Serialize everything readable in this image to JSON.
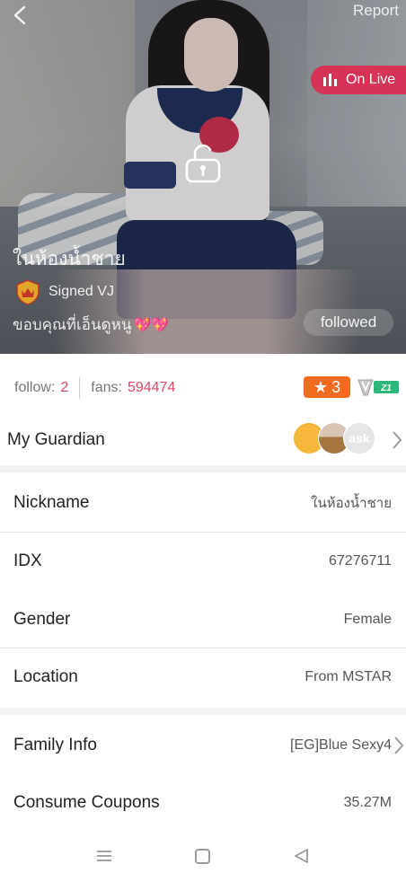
{
  "header": {
    "report_label": "Report",
    "live_badge_label": "On Live"
  },
  "profile": {
    "display_name": "ในห้องน้ำชาย",
    "signed_label": "Signed VJ",
    "bio": "ขอบคุณที่เอ็นดูหนู",
    "bio_emoji": "💖💖",
    "followed_label": "followed"
  },
  "stats": {
    "follow_label": "follow:",
    "follow_value": "2",
    "fans_label": "fans:",
    "fans_value": "594474",
    "level_value": "3",
    "vip_label": "Z1"
  },
  "guardian": {
    "label": "My Guardian",
    "avatar_text": "ask"
  },
  "details": [
    {
      "label": "Nickname",
      "value": "ในห้องน้ำชาย"
    },
    {
      "label": "IDX",
      "value": "67276711"
    },
    {
      "label": "Gender",
      "value": "Female"
    },
    {
      "label": "Location",
      "value": "From MSTAR"
    }
  ],
  "extra": [
    {
      "label": "Family Info",
      "value": "[EG]Blue Sexy4"
    },
    {
      "label": "Consume Coupons",
      "value": "35.27M"
    }
  ],
  "colors": {
    "accent_pink": "#d84a66",
    "live_red": "#d63457",
    "level_orange": "#f26b1f",
    "vip_green": "#2bb87a"
  }
}
